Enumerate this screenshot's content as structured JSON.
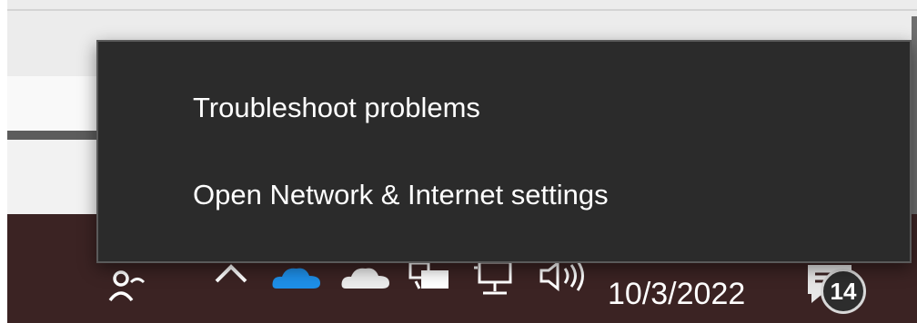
{
  "context_menu": {
    "items": [
      {
        "label": "Troubleshoot problems"
      },
      {
        "label": "Open Network & Internet settings"
      }
    ]
  },
  "taskbar": {
    "clock": {
      "date": "10/3/2022"
    },
    "notifications": {
      "count": "14"
    },
    "tray_icons": [
      "people-icon",
      "show-hidden-icons-chevron-icon",
      "onedrive-blue-icon",
      "onedrive-white-icon",
      "device-icon",
      "network-wired-icon",
      "volume-icon"
    ]
  },
  "colors": {
    "menu_background": "#2b2b2b",
    "menu_text": "#ffffff",
    "taskbar_background": "#3b2323",
    "onedrive_blue": "#1e8fe8"
  }
}
